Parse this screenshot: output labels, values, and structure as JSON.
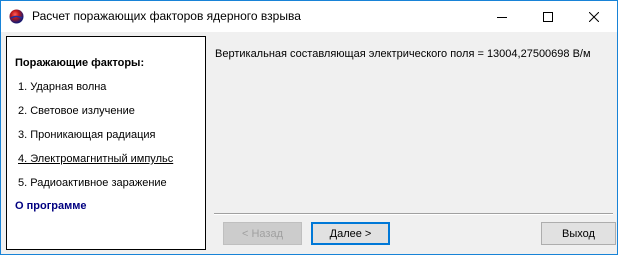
{
  "window": {
    "title": "Расчет поражающих факторов ядерного взрыва",
    "icon": "globe-app-icon",
    "accent_color": "#1883d7"
  },
  "sidebar": {
    "heading": "Поражающие факторы:",
    "items": [
      {
        "label": "1. Ударная волна",
        "active": false
      },
      {
        "label": "2. Световое излучение",
        "active": false
      },
      {
        "label": "3. Проникающая радиация",
        "active": false
      },
      {
        "label": "4. Электромагнитный импульс",
        "active": true
      },
      {
        "label": "5. Радиоактивное заражение",
        "active": false
      }
    ],
    "about_label": "О программе",
    "about_color": "#000080"
  },
  "main": {
    "result_text": "Вертикальная составляющая электрического поля =  13004,27500698  В/м"
  },
  "buttons": {
    "back_label": "< Назад",
    "back_enabled": false,
    "next_label": "Далее >",
    "exit_label": "Выход"
  }
}
